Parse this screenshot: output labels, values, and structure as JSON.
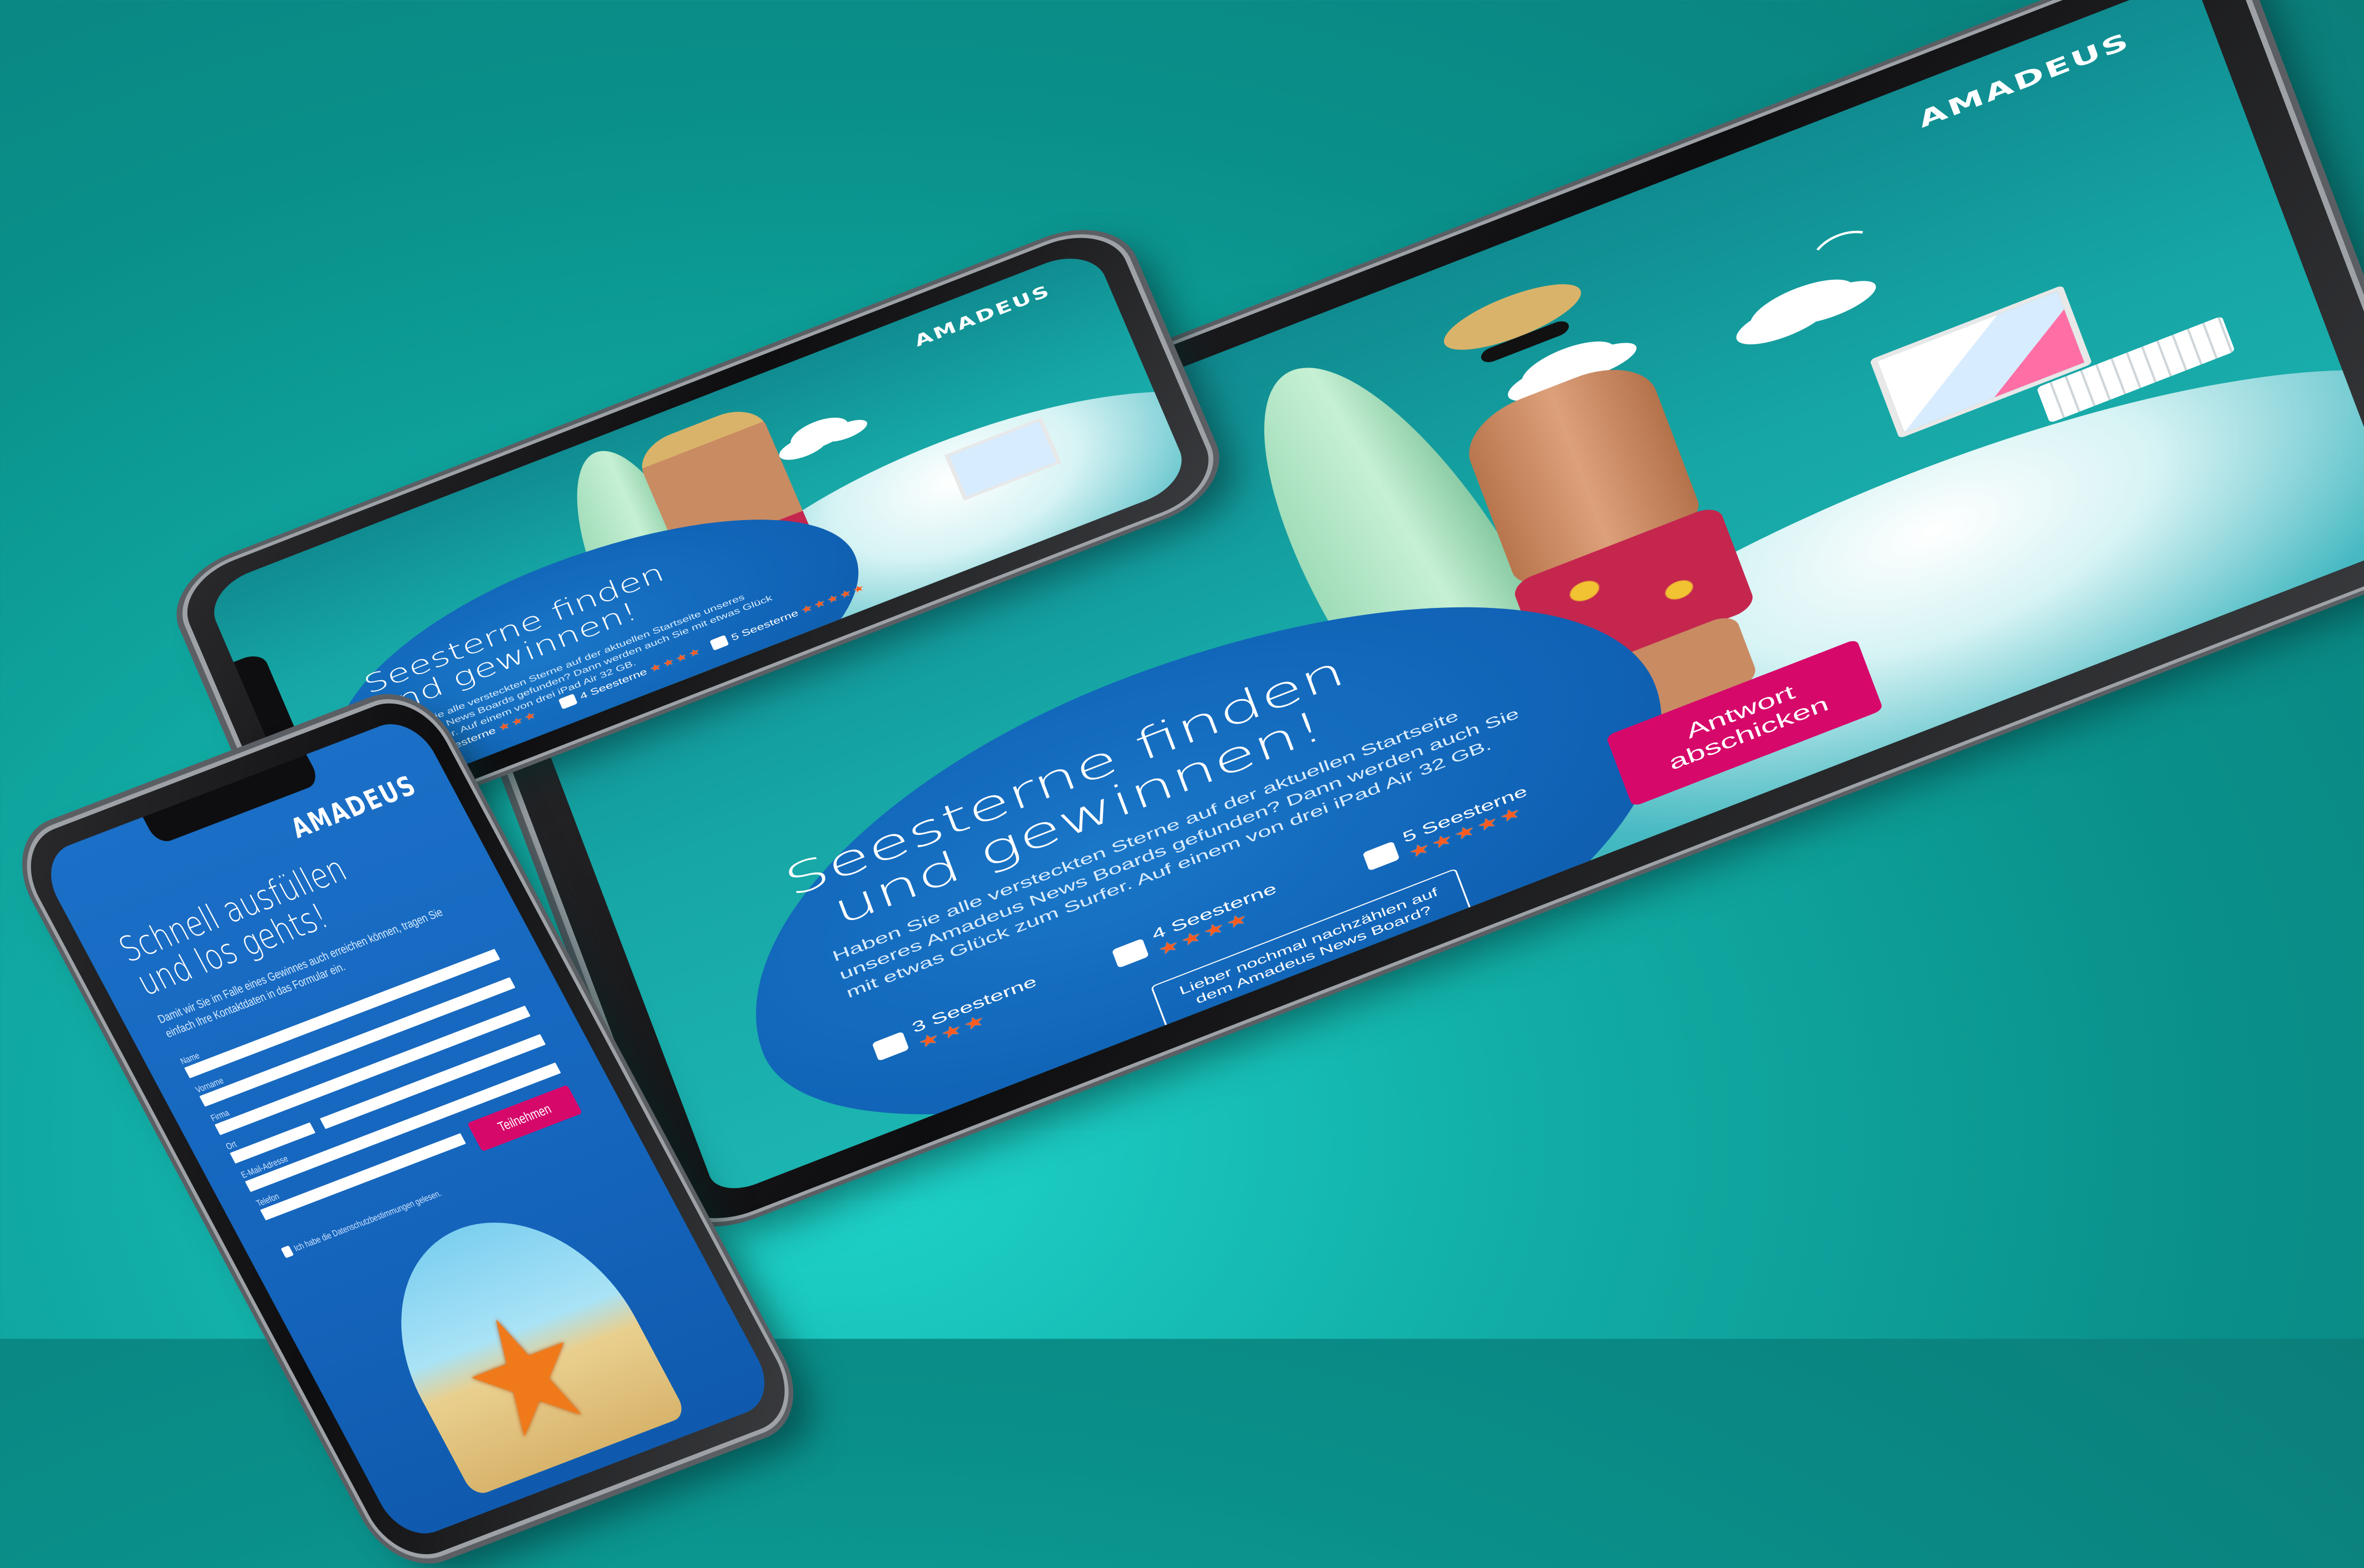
{
  "brand": {
    "logo_text": "AMADEUS"
  },
  "tablet": {
    "headline_line1": "Seesterne finden",
    "headline_line2": "und gewinnen!",
    "description": "Haben Sie alle versteckten Sterne auf der aktuellen Startseite unseres Amadeus News Boards gefunden? Dann werden auch Sie mit etwas Glück zum Surfer. Auf einem von drei iPad Air 32 GB.",
    "options": [
      {
        "label": "3 Seesterne",
        "stars": "★★★"
      },
      {
        "label": "4 Seesterne",
        "stars": "★★★★"
      },
      {
        "label": "5 Seesterne",
        "stars": "★★★★★"
      }
    ],
    "submit_label_line1": "Antwort",
    "submit_label_line2": "abschicken",
    "recount_label": "Lieber nochmal nachzählen auf dem Amadeus News Board?"
  },
  "phone_top": {
    "headline_line1": "Seesterne finden",
    "headline_line2": "und gewinnen!",
    "description": "Haben Sie alle versteckten Sterne auf der aktuellen Startseite unseres Amadeus News Boards gefunden? Dann werden auch Sie mit etwas Glück zum Surfer. Auf einem von drei iPad Air 32 GB.",
    "options": [
      {
        "label": "3 Seesterne",
        "stars": "★★★"
      },
      {
        "label": "4 Seesterne",
        "stars": "★★★★"
      },
      {
        "label": "5 Seesterne",
        "stars": "★★★★★"
      }
    ]
  },
  "phone_form": {
    "headline_line1": "Schnell ausfüllen",
    "headline_line2": "und los gehts!",
    "intro": "Damit wir Sie im Falle eines Gewinnes auch erreichen können, tragen Sie einfach Ihre Kontaktdaten in das Formular ein.",
    "fields": [
      "Name",
      "Vorname",
      "Firma",
      "Ort",
      "E-Mail-Adresse",
      "Telefon"
    ],
    "privacy_label": "Ich habe die Datenschutzbestimmungen gelesen.",
    "submit_label": "Teilnehmen"
  }
}
